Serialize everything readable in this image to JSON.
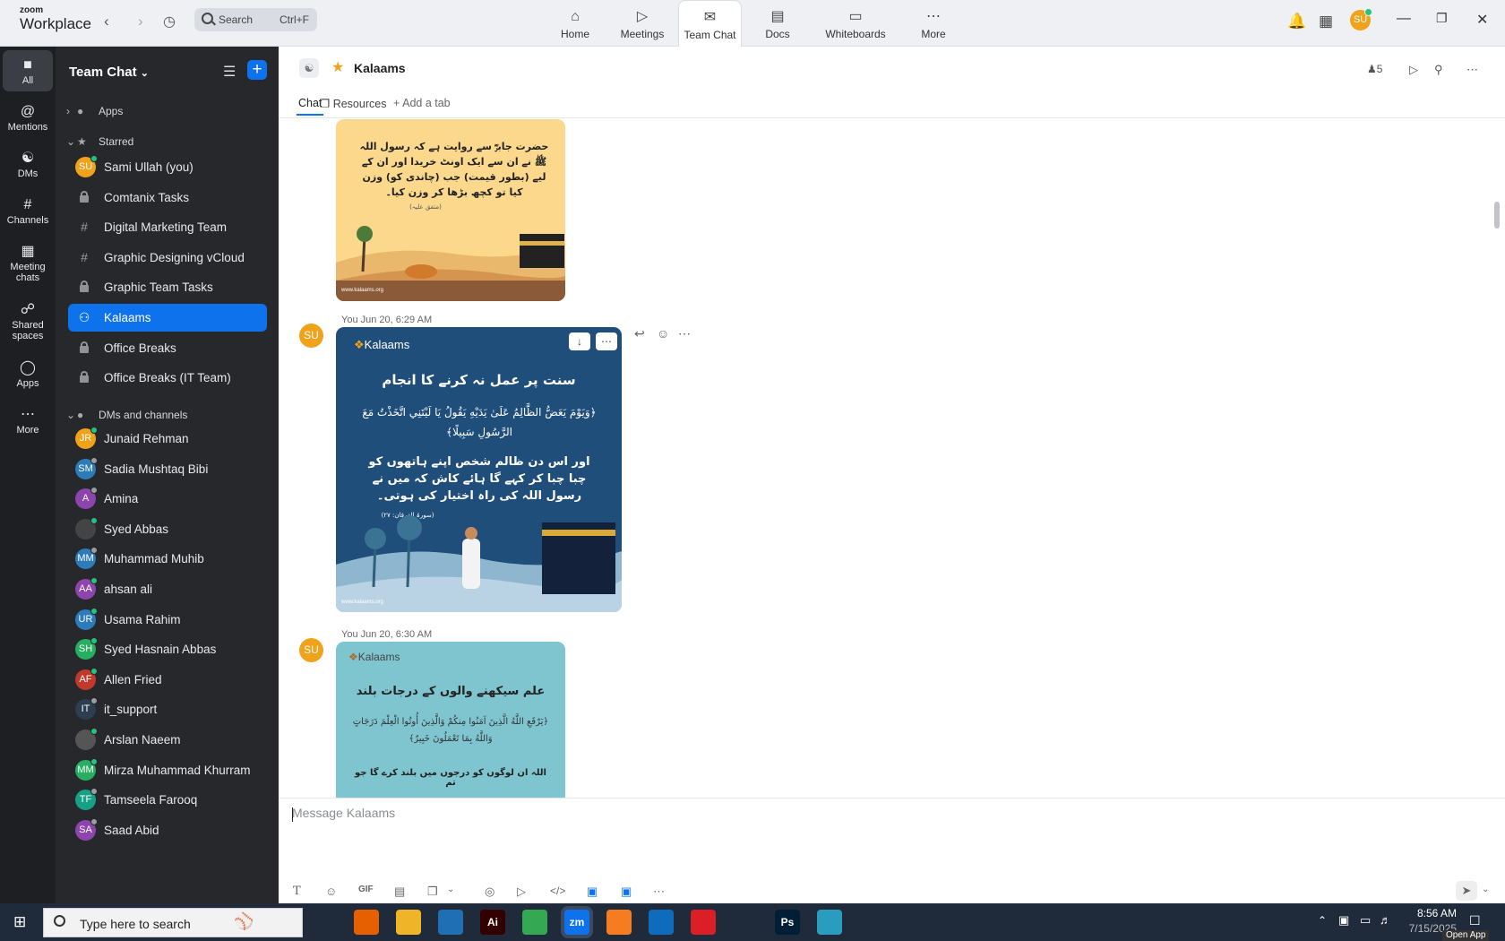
{
  "titlebar": {
    "brand_top": "zoom",
    "brand_bottom": "Workplace",
    "search_placeholder": "Search",
    "search_shortcut": "Ctrl+F",
    "nav_tabs": [
      {
        "label": "Home",
        "icon": "home-icon"
      },
      {
        "label": "Meetings",
        "icon": "video-icon"
      },
      {
        "label": "Team Chat",
        "icon": "chat-icon"
      },
      {
        "label": "Docs",
        "icon": "doc-icon"
      },
      {
        "label": "Whiteboards",
        "icon": "whiteboard-icon"
      },
      {
        "label": "More",
        "icon": "more-icon"
      }
    ],
    "avatar_initials": "SU"
  },
  "rail": [
    {
      "label": "All",
      "icon": "chat-bubble-icon"
    },
    {
      "label": "Mentions",
      "icon": "at-icon"
    },
    {
      "label": "DMs",
      "icon": "people-icon"
    },
    {
      "label": "Channels",
      "icon": "hash-icon"
    },
    {
      "label": "Meeting chats",
      "icon": "calendar-icon"
    },
    {
      "label": "Shared spaces",
      "icon": "share-icon"
    },
    {
      "label": "Apps",
      "icon": "apps-icon"
    },
    {
      "label": "More",
      "icon": "more-icon"
    }
  ],
  "sidebar": {
    "title": "Team Chat",
    "sections": {
      "apps": "Apps",
      "starred": "Starred",
      "dms": "DMs and channels"
    },
    "starred": [
      {
        "label": "Sami Ullah (you)",
        "type": "avatar",
        "initials": "SU",
        "color": "#f0a21a",
        "status": "#26c281"
      },
      {
        "label": "Comtanix Tasks",
        "type": "lock"
      },
      {
        "label": "Digital Marketing Team",
        "type": "hash"
      },
      {
        "label": "Graphic Designing vCloud",
        "type": "hash"
      },
      {
        "label": "Graphic Team Tasks",
        "type": "lock"
      },
      {
        "label": "Kalaams",
        "type": "group",
        "selected": true
      },
      {
        "label": "Office Breaks",
        "type": "lock"
      },
      {
        "label": "Office Breaks (IT Team)",
        "type": "lock"
      }
    ],
    "dms": [
      {
        "label": "Junaid Rehman",
        "initials": "JR",
        "color": "#f0a21a",
        "status": "#26c281"
      },
      {
        "label": "Sadia Mushtaq Bibi",
        "initials": "SM",
        "color": "#2d7bb8",
        "status": "#9a9da2"
      },
      {
        "label": "Amina",
        "initials": "A",
        "color": "#8e44ad",
        "status": "#9a9da2"
      },
      {
        "label": "Syed Abbas",
        "initials": "",
        "color": "#444",
        "status": "#26c281"
      },
      {
        "label": "Muhammad Muhib",
        "initials": "MM",
        "color": "#2d7bb8",
        "status": "#9a9da2"
      },
      {
        "label": "ahsan ali",
        "initials": "AA",
        "color": "#8e44ad",
        "status": "#26c281"
      },
      {
        "label": "Usama Rahim",
        "initials": "UR",
        "color": "#2d7bb8",
        "status": "#26c281"
      },
      {
        "label": "Syed Hasnain Abbas",
        "initials": "SH",
        "color": "#27ae60",
        "status": "#26c281"
      },
      {
        "label": "Allen Fried",
        "initials": "AF",
        "color": "#c0392b",
        "status": "#26c281"
      },
      {
        "label": "it_support",
        "initials": "IT",
        "color": "#2c3e50",
        "status": "#9a9da2"
      },
      {
        "label": "Arslan Naeem",
        "initials": "",
        "color": "#555",
        "status": "#26c281"
      },
      {
        "label": "Mirza Muhammad Khurram",
        "initials": "MM",
        "color": "#27ae60",
        "status": "#26c281"
      },
      {
        "label": "Tamseela Farooq",
        "initials": "TF",
        "color": "#16a085",
        "status": "#9a9da2"
      },
      {
        "label": "Saad Abid",
        "initials": "SA",
        "color": "#8e44ad",
        "status": "#9a9da2"
      }
    ]
  },
  "channel": {
    "name": "Kalaams",
    "member_count": "5",
    "tabs": [
      "Chat",
      "Resources",
      "Add a tab"
    ]
  },
  "messages": [
    {
      "urdu_text": "حضرت جابرؓ سے روایت ہے کہ رسول اللہ ﷺ نے ان سے ایک اونٹ خریدا اور ان کے لیے (بطور قیمت) جب (چاندی کو) وزن کیا تو کچھ بڑھا کر وزن کیا۔",
      "source": "(متفق علیہ)",
      "footer": "www.kalaams.org"
    },
    {
      "meta": "You Jun 20, 6:29 AM",
      "initials": "SU",
      "logo": "Kalaams",
      "heading": "سنت پر عمل نہ کرنے کا انجام",
      "arabic": "﴿وَيَوْمَ يَعَضُّ الظَّالِمُ عَلَىٰ يَدَيْهِ يَقُولُ يَا لَيْتَنِي اتَّخَذْتُ مَعَ الرَّسُولِ سَبِيلًا﴾",
      "translation": "اور اس دن ظالم شخص اپنے ہاتھوں کو چبا چبا کر کہے گا ہائے کاش کہ میں نے رسول اللہ کی راہ اختیار کی ہوتی۔",
      "source": "(سورۃ الفرقان: ۲۷)",
      "footer": "www.kalaams.org"
    },
    {
      "meta": "You Jun 20, 6:30 AM",
      "initials": "SU",
      "logo": "Kalaams",
      "heading": "علم سیکھنے والوں کے درجات بلند",
      "arabic": "﴿يَرْفَعِ اللَّهُ الَّذِينَ آمَنُوا مِنكُمْ وَالَّذِينَ أُوتُوا الْعِلْمَ دَرَجَاتٍ وَاللَّهُ بِمَا تَعْمَلُونَ خَبِيرٌ﴾",
      "translation": "اللہ ان لوگوں کو درجوں میں بلند کرے گا جو تم"
    }
  ],
  "composer": {
    "placeholder": "Message Kalaams",
    "toolbar": [
      "text-format-icon",
      "emoji-icon",
      "GIF",
      "file-icon",
      "screenshot-icon",
      "mic-icon",
      "video-clip-icon",
      "code-icon",
      "app-icon",
      "whiteboard-icon",
      "more-icon"
    ],
    "gif_label": "GIF"
  },
  "taskbar": {
    "search_placeholder": "Type here to search",
    "time": "8:56 AM",
    "date": "7/15/2025",
    "tooltip": "Open App",
    "apps": [
      {
        "label": "",
        "icon": "task-view-icon",
        "color": "#1f2b3b"
      },
      {
        "label": "",
        "icon": "firefox-icon",
        "color": "#e66000"
      },
      {
        "label": "",
        "icon": "folder-icon",
        "color": "#f0b429"
      },
      {
        "label": "",
        "icon": "vscode-icon",
        "color": "#1f6fb5"
      },
      {
        "label": "Ai",
        "icon": "illustrator-icon",
        "color": "#330000"
      },
      {
        "label": "",
        "icon": "chrome-icon",
        "color": "#34a853"
      },
      {
        "label": "zm",
        "icon": "zoom-icon",
        "color": "#0e72ed"
      },
      {
        "label": "",
        "icon": "xampp-icon",
        "color": "#f57c20"
      },
      {
        "label": "",
        "icon": "outlook-icon",
        "color": "#0f6cbd"
      },
      {
        "label": "",
        "icon": "creative-cloud-icon",
        "color": "#da1f26"
      },
      {
        "label": "",
        "icon": "pen-tool-icon",
        "color": "#1f2b3b"
      },
      {
        "label": "Ps",
        "icon": "photoshop-icon",
        "color": "#001e36"
      },
      {
        "label": "",
        "icon": "app-icon",
        "color": "#2a9dbf"
      }
    ]
  }
}
